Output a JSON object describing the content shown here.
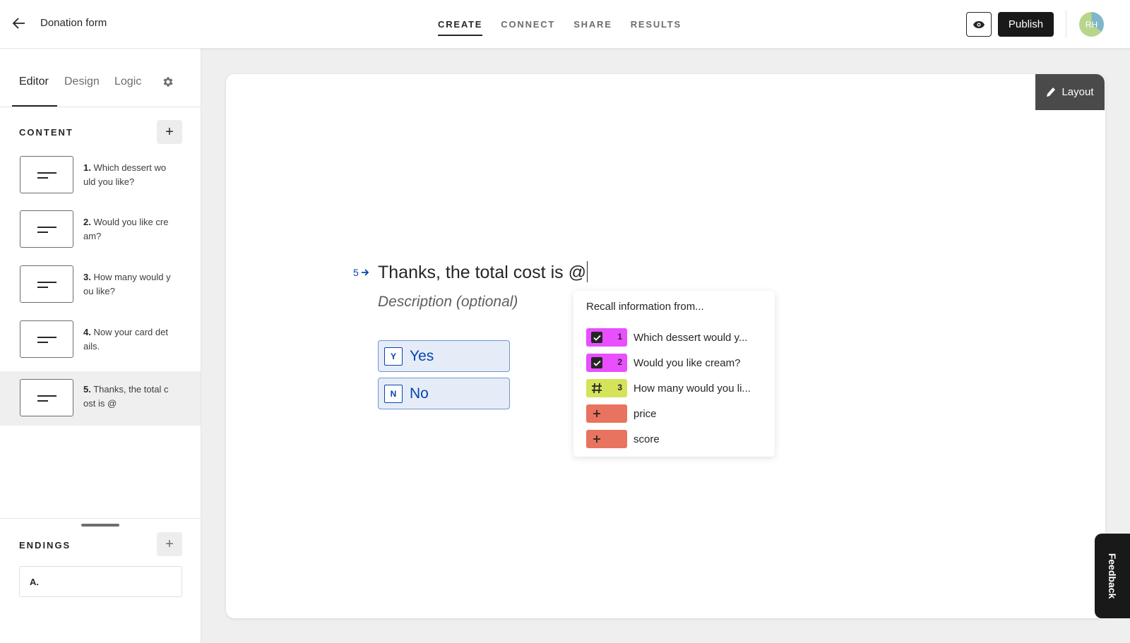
{
  "header": {
    "form_title": "Donation form",
    "tabs": [
      "CREATE",
      "CONNECT",
      "SHARE",
      "RESULTS"
    ],
    "active_tab": "CREATE",
    "publish_label": "Publish",
    "avatar_initials": "RH"
  },
  "sidebar": {
    "tabs": [
      "Editor",
      "Design",
      "Logic"
    ],
    "active_tab": "Editor",
    "content_label": "CONTENT",
    "questions": [
      {
        "num": "1.",
        "text": "Which dessert would you like?"
      },
      {
        "num": "2.",
        "text": "Would you like cream?"
      },
      {
        "num": "3.",
        "text": "How many would you like?"
      },
      {
        "num": "4.",
        "text": "Now your card details."
      },
      {
        "num": "5.",
        "text": "Thanks, the total cost is @"
      }
    ],
    "selected_question": 5,
    "endings_label": "ENDINGS",
    "ending_item": "A."
  },
  "canvas": {
    "layout_label": "Layout",
    "question_number": "5",
    "question_title": "Thanks, the total cost is @",
    "description_placeholder": "Description (optional)",
    "choices": [
      {
        "key": "Y",
        "label": "Yes"
      },
      {
        "key": "N",
        "label": "No"
      }
    ],
    "accent_color": "#0445af"
  },
  "recall_popup": {
    "heading": "Recall information from...",
    "items": [
      {
        "icon": "checkbox-icon",
        "num": "1",
        "label": "Which dessert would y...",
        "color": "#e94eff"
      },
      {
        "icon": "checkbox-icon",
        "num": "2",
        "label": "Would you like cream?",
        "color": "#e94eff"
      },
      {
        "icon": "hash-icon",
        "num": "3",
        "label": "How many would you li...",
        "color": "#d5e35a"
      },
      {
        "icon": "plus-icon",
        "num": "",
        "label": "price",
        "color": "#e8735e"
      },
      {
        "icon": "plus-icon",
        "num": "",
        "label": "score",
        "color": "#e8735e"
      }
    ]
  },
  "feedback_label": "Feedback"
}
